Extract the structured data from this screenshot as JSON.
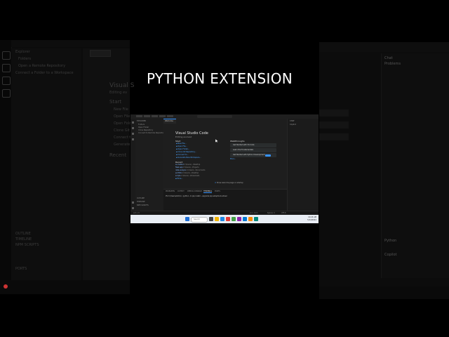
{
  "overlay_title": "PYTHON EXTENSION",
  "vscode": {
    "tab": "Welcome",
    "welcome_title": "Visual Studio Code",
    "welcome_subtitle": "Editing evolved",
    "start_heading": "Start",
    "start_links": [
      "New File...",
      "Open File...",
      "Open Folder...",
      "Clone Git Repository...",
      "Connect to...",
      "Generate New Workspace..."
    ],
    "recent_heading": "Recent",
    "recent_items": [
      {
        "name": "ai-chatbot",
        "path": "C:\\Users\\...\\Desktop"
      },
      {
        "name": "flask-app",
        "path": "C:\\Users\\...\\Projects"
      },
      {
        "name": "data-analysis",
        "path": "C:\\Users\\...\\Documents"
      },
      {
        "name": "portfolio",
        "path": "C:\\Users\\...\\Desktop"
      },
      {
        "name": "scripts",
        "path": "C:\\Users\\...\\Downloads"
      }
    ],
    "more_label": "More...",
    "walkthroughs_heading": "Walkthroughs",
    "walkthroughs": [
      "Get Started with VS Code",
      "Learn the Fundamentals",
      "Get Started with Python Development"
    ],
    "walkthrough_badge": "New",
    "walk_more": "More...",
    "show_welcome": "Show welcome page on startup",
    "sidebar_header": "EXPLORER",
    "sidebar_items": [
      "Folders",
      "Open Folder",
      "Clone Repository",
      "Connect to Remote Repository..."
    ],
    "sidebar_bottom": [
      "OUTLINE",
      "TIMELINE",
      "NPM SCRIPTS"
    ],
    "panel_tabs": [
      "PROBLEMS",
      "OUTPUT",
      "DEBUG CONSOLE",
      "TERMINAL",
      "PORTS"
    ],
    "terminal_line": "PS C:\\Users\\Admin> python -m pip install --upgrade pip  setuptools wheel",
    "right_panel": [
      "CHAT",
      "Copilot"
    ],
    "status_items": [
      "⊗ 0  ⚠ 0",
      "Ln 1, Col 1",
      "Spaces: 4",
      "UTF-8"
    ],
    "taskbar_search": "Search",
    "clock": [
      "10:24 AM",
      "5/14/2024"
    ]
  },
  "background": {
    "left_lines": [
      "Explorer",
      "Folders",
      "Open a Remote Repository",
      "Connect a Folder to a Workspace",
      "Visual S",
      "Editing ev",
      "Start",
      "New File",
      "Open File",
      "Open Folder",
      "Clone Git",
      "Connect to",
      "Generate",
      "Recent",
      "OUTLINE",
      "TIMELINE",
      "NPM SCRIPTS",
      "PORTS"
    ],
    "right_lines": [
      "Chat",
      "Problems",
      "Python",
      "Copilot"
    ]
  },
  "colors": {
    "accent": "#3794ff",
    "badge": "#cc3333",
    "taskbar": "#e9eef5"
  }
}
